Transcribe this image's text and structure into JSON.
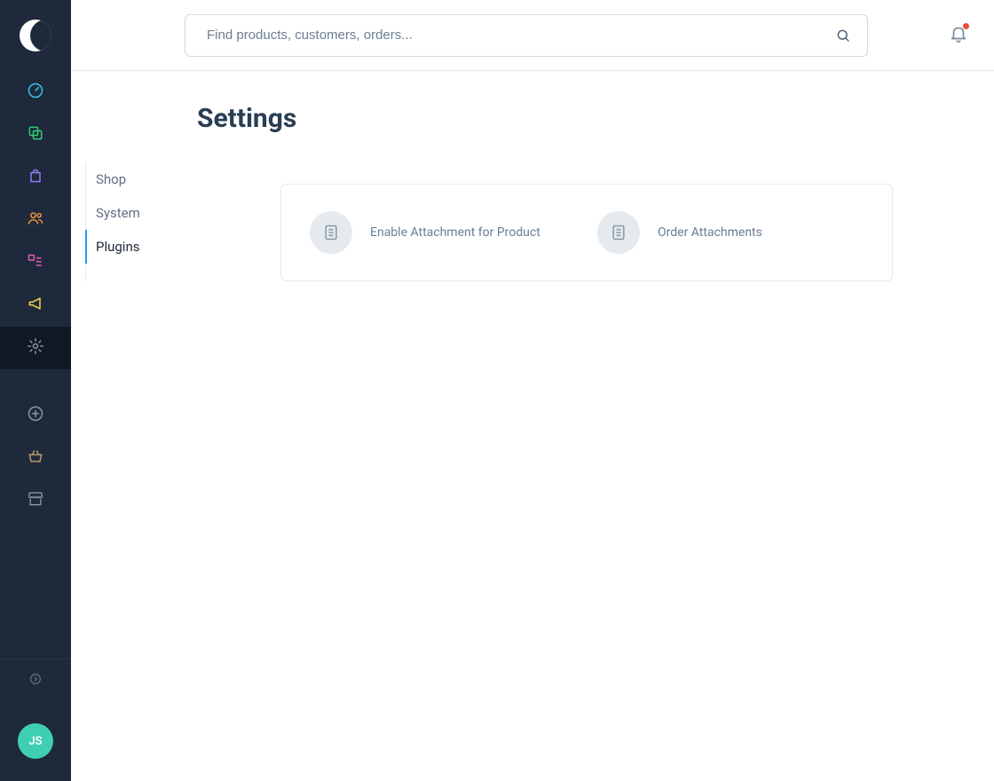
{
  "header": {
    "search_placeholder": "Find products, customers, orders..."
  },
  "page": {
    "title": "Settings"
  },
  "tabs": {
    "shop": "Shop",
    "system": "System",
    "plugins": "Plugins"
  },
  "plugins": {
    "enable_attachment": "Enable Attachment for Product",
    "order_attachments": "Order Attachments"
  },
  "user": {
    "initials": "JS"
  },
  "colors": {
    "dashboard": "#34c6eb",
    "catalog": "#2ecc71",
    "orders": "#8e7cf0",
    "customers": "#f0923b",
    "content": "#e85bb5",
    "marketing": "#f7d548",
    "settings": "#8896a6",
    "add": "#8896a6",
    "extensions": "#b89b6b",
    "marketplace": "#8896a6",
    "expand": "#6b7e90",
    "search_icon": "#52667a",
    "bell": "#7a8a9c",
    "plugin_icon": "#8896a6"
  }
}
